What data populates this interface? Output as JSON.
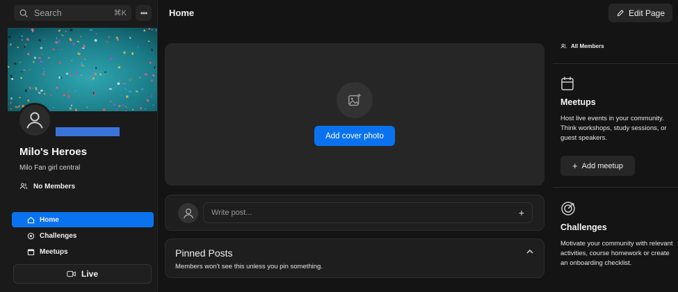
{
  "search": {
    "placeholder": "Search",
    "shortcut": "⌘K"
  },
  "group": {
    "name": "Milo's Heroes",
    "description": "Milo Fan girl central",
    "members_label": "No Members"
  },
  "nav": {
    "items": [
      {
        "label": "Home",
        "icon": "home-icon",
        "active": true
      },
      {
        "label": "Challenges",
        "icon": "challenge-icon",
        "active": false
      },
      {
        "label": "Meetups",
        "icon": "calendar-icon",
        "active": false
      }
    ],
    "live_label": "Live"
  },
  "header": {
    "title": "Home",
    "edit_label": "Edit Page"
  },
  "main": {
    "add_cover_label": "Add cover photo",
    "write_placeholder": "Write post...",
    "pinned_title": "Pinned Posts",
    "pinned_subtitle": "Members won't see this unless you pin something."
  },
  "right_panel": {
    "all_members_label": "All Members",
    "meetups": {
      "title": "Meetups",
      "description": "Host live events in your community. Think workshops, study sessions, or guest speakers.",
      "button_label": "Add meetup"
    },
    "challenges": {
      "title": "Challenges",
      "description": "Motivate your community with relevant activities, course homework or create an onboarding checklist."
    }
  },
  "colors": {
    "accent": "#0a72ef",
    "background": "#141414",
    "card": "#262626"
  }
}
